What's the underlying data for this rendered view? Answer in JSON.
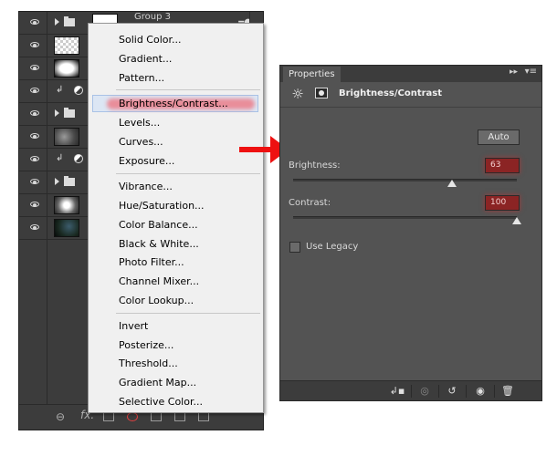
{
  "layers_panel": {
    "group_name": "Group 3",
    "footer": {
      "link_icon": "link-icon",
      "fx_label": "fx."
    }
  },
  "adjustment_menu": {
    "items": [
      "Solid Color...",
      "Gradient...",
      "Pattern...",
      "Brightness/Contrast...",
      "Levels...",
      "Curves...",
      "Exposure...",
      "Vibrance...",
      "Hue/Saturation...",
      "Color Balance...",
      "Black & White...",
      "Photo Filter...",
      "Channel Mixer...",
      "Color Lookup...",
      "Invert",
      "Posterize...",
      "Threshold...",
      "Gradient Map...",
      "Selective Color..."
    ],
    "highlighted": "Brightness/Contrast...",
    "highlight_color": "#f44650"
  },
  "arrow": {
    "color": "#ee1111"
  },
  "properties_panel": {
    "tab_label": "Properties",
    "collapse_glyph": "▸▸",
    "menu_glyph": "▾≡",
    "title": "Brightness/Contrast",
    "auto_label": "Auto",
    "brightness": {
      "label": "Brightness:",
      "value": "63",
      "slider_value": 63,
      "min": -150,
      "max": 150
    },
    "contrast": {
      "label": "Contrast:",
      "value": "100",
      "slider_value": 100,
      "min": -50,
      "max": 100
    },
    "use_legacy": {
      "label": "Use Legacy",
      "checked": false
    },
    "footer_icons": [
      "clip-to-layer-icon",
      "view-previous-icon",
      "reset-icon",
      "visibility-icon",
      "trash-icon"
    ],
    "value_field_color": "#8b2424"
  }
}
